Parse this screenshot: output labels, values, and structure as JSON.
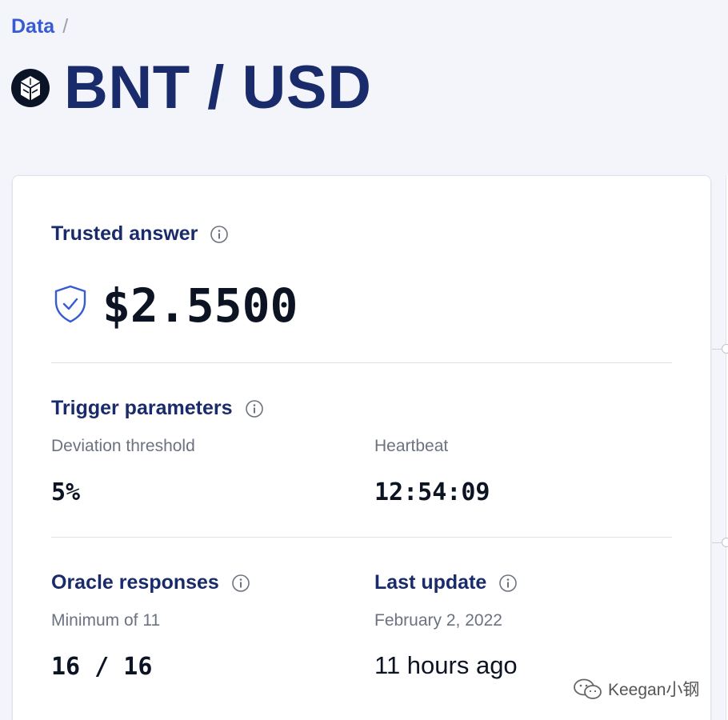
{
  "breadcrumb": {
    "link": "Data",
    "separator": "/"
  },
  "pair": {
    "title": "BNT / USD",
    "logo_icon": "bancor-logo"
  },
  "trusted_answer": {
    "title": "Trusted answer",
    "value": "$2.5500",
    "shield_icon": "shield-check-icon"
  },
  "trigger_parameters": {
    "title": "Trigger parameters",
    "deviation_label": "Deviation threshold",
    "deviation_value": "5%",
    "heartbeat_label": "Heartbeat",
    "heartbeat_value": "12:54:09"
  },
  "oracle_responses": {
    "title": "Oracle responses",
    "minimum_label": "Minimum of 11",
    "value": "16 / 16"
  },
  "last_update": {
    "title": "Last update",
    "date": "February 2, 2022",
    "relative": "11 hours ago"
  },
  "watermark": {
    "text": "Keegan小钢"
  },
  "colors": {
    "accent": "#375bd2",
    "title_navy": "#1a2b6b",
    "value_dark": "#0c1424",
    "muted": "#6c7280",
    "background": "#f4f5fb"
  }
}
